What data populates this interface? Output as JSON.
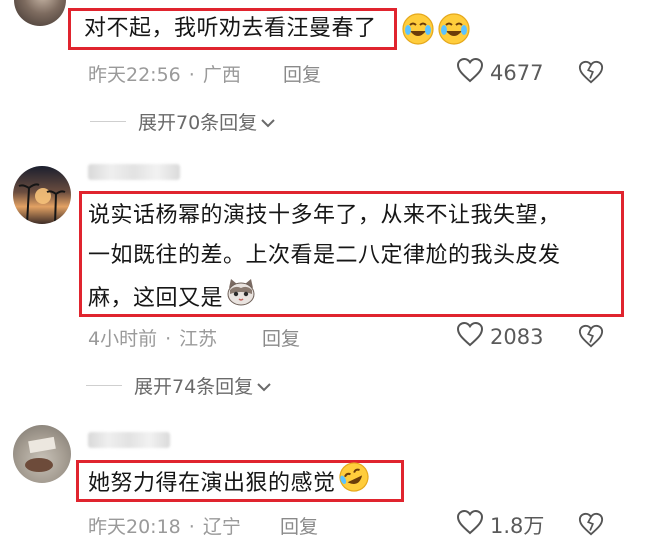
{
  "comments": [
    {
      "text": "对不起，我听劝去看汪曼春了",
      "time": "昨天22:56",
      "location": "广西",
      "reply_label": "回复",
      "likes": "4677",
      "expand_label": "展开70条回复",
      "emoji": "crying-laughing-icon"
    },
    {
      "text_lines": [
        "说实话杨幂的演技十多年了，从来不让我失望，",
        "一如既往的差。上次看是二八定律尬的我头皮发",
        "麻，这回又是"
      ],
      "time": "4小时前",
      "location": "江苏",
      "reply_label": "回复",
      "likes": "2083",
      "expand_label": "展开74条回复",
      "emoji": "cat-face-icon"
    },
    {
      "text": "她努力得在演出狠的感觉",
      "time": "昨天20:18",
      "location": "辽宁",
      "reply_label": "回复",
      "likes": "1.8万",
      "emoji": "rofl-icon"
    }
  ],
  "colors": {
    "highlight": "#e0242e",
    "meta": "#9a9a9a"
  }
}
